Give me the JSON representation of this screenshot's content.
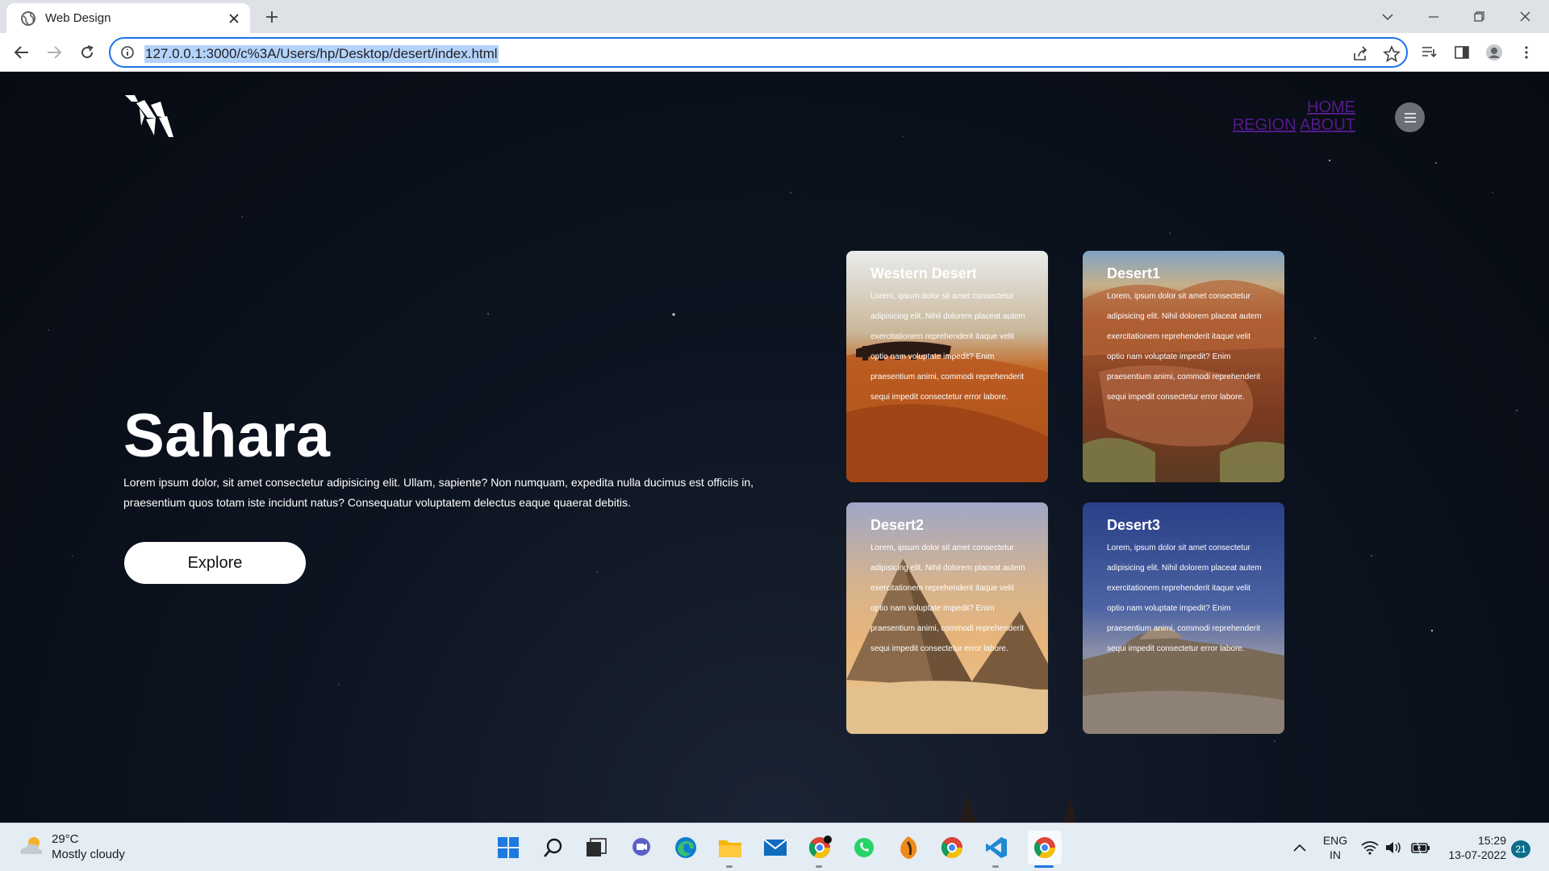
{
  "browser": {
    "tab_title": "Web Design",
    "url": "127.0.0.1:3000/c%3A/Users/hp/Desktop/desert/index.html"
  },
  "site": {
    "nav": {
      "home": "HOME",
      "region": "REGION",
      "about": "ABOUT"
    },
    "hero": {
      "title": "Sahara",
      "text": "Lorem ipsum dolor, sit amet consectetur adipisicing elit. Ullam, sapiente? Non numquam, expedita nulla ducimus est officiis in, praesentium quos totam iste incidunt natus? Consequatur voluptatem delectus eaque quaerat debitis.",
      "button": "Explore"
    },
    "cards": [
      {
        "title": "Western Desert",
        "text": "Lorem, ipsum dolor sit amet consectetur adipisicing elit. Nihil dolorem placeat autem exercitationem reprehenderit itaque velit optio nam voluptate impedit? Enim praesentium animi, commodi reprehenderit sequi impedit consectetur error labore."
      },
      {
        "title": "Desert1",
        "text": "Lorem, ipsum dolor sit amet consectetur adipisicing elit. Nihil dolorem placeat autem exercitationem reprehenderit itaque velit optio nam voluptate impedit? Enim praesentium animi, commodi reprehenderit sequi impedit consectetur error labore."
      },
      {
        "title": "Desert2",
        "text": "Lorem, ipsum dolor sit amet consectetur adipisicing elit. Nihil dolorem placeat autem exercitationem reprehenderit itaque velit optio nam voluptate impedit? Enim praesentium animi, commodi reprehenderit sequi impedit consectetur error labore."
      },
      {
        "title": "Desert3",
        "text": "Lorem, ipsum dolor sit amet consectetur adipisicing elit. Nihil dolorem placeat autem exercitationem reprehenderit itaque velit optio nam voluptate impedit? Enim praesentium animi, commodi reprehenderit sequi impedit consectetur error labore."
      }
    ]
  },
  "taskbar": {
    "weather": {
      "temp": "29°C",
      "condition": "Mostly cloudy"
    },
    "lang": {
      "line1": "ENG",
      "line2": "IN"
    },
    "clock": {
      "time": "15:29",
      "date": "13-07-2022"
    },
    "notifications": "21"
  },
  "colors": {
    "accent": "#1a73e8",
    "link": "#551a8b",
    "page_bg": "#0b111b"
  }
}
